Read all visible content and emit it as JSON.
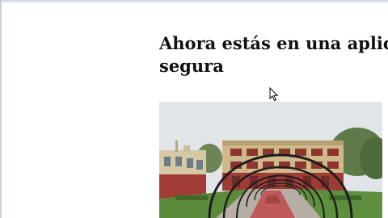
{
  "page": {
    "heading_line1": "Ahora estás en una aplicacio",
    "heading_line2": "segura"
  },
  "image": {
    "subject": "school courtyard with metal arches and two-storey building"
  },
  "cursor": {
    "icon": "arrow-cursor-icon"
  },
  "colors": {
    "heading_text": "#111111",
    "sky": "#dfe3e6",
    "building_wall": "#c9b98a",
    "building_red": "#9c3a36",
    "lawn": "#5c8a3c",
    "arch": "#1c1c1c"
  }
}
